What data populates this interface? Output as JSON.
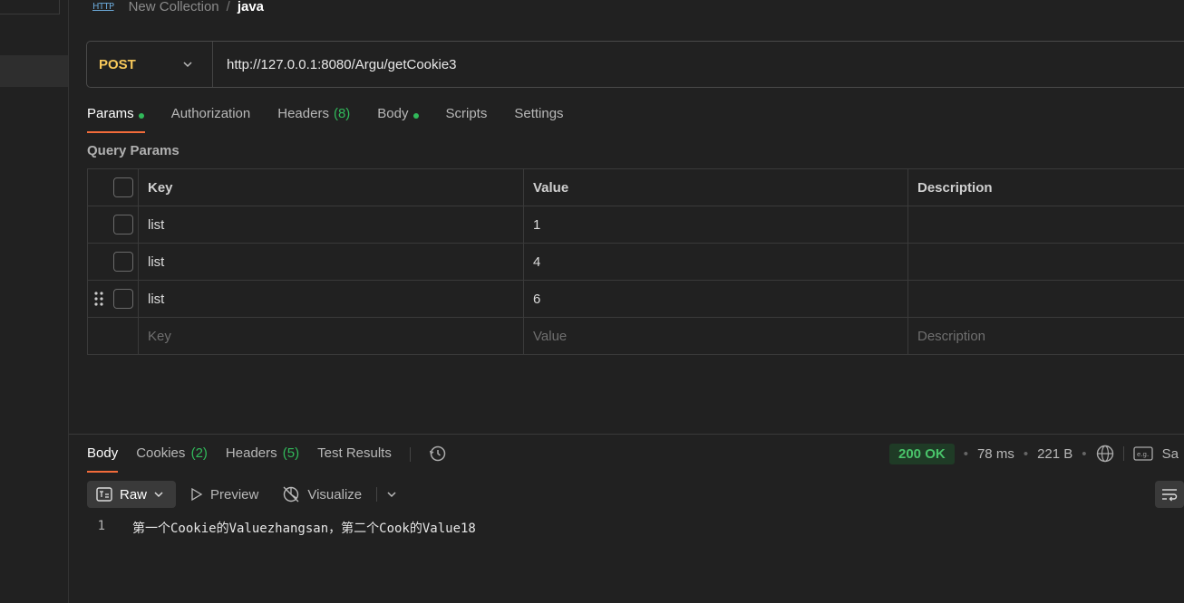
{
  "breadcrumb": {
    "icon_text": "HTTP",
    "parent": "New Collection",
    "separator": "/",
    "current": "java"
  },
  "request": {
    "method": "POST",
    "url": "http://127.0.0.1:8080/Argu/getCookie3"
  },
  "request_tabs": [
    {
      "label": "Params",
      "dot": true,
      "active": true
    },
    {
      "label": "Authorization"
    },
    {
      "label": "Headers",
      "count": "(8)"
    },
    {
      "label": "Body",
      "dot": true
    },
    {
      "label": "Scripts"
    },
    {
      "label": "Settings"
    }
  ],
  "query_params": {
    "title": "Query Params",
    "headers": {
      "key": "Key",
      "value": "Value",
      "description": "Description"
    },
    "rows": [
      {
        "key": "list",
        "value": "1",
        "description": ""
      },
      {
        "key": "list",
        "value": "4",
        "description": ""
      },
      {
        "key": "list",
        "value": "6",
        "description": ""
      }
    ],
    "placeholders": {
      "key": "Key",
      "value": "Value",
      "description": "Description"
    }
  },
  "response_tabs": {
    "body": "Body",
    "cookies": "Cookies",
    "cookies_count": "(2)",
    "headers": "Headers",
    "headers_count": "(5)",
    "test_results": "Test Results"
  },
  "response_status": {
    "status": "200 OK",
    "time": "78 ms",
    "size": "221 B",
    "save_label_partial": "Sa"
  },
  "view_modes": {
    "raw": "Raw",
    "preview": "Preview",
    "visualize": "Visualize"
  },
  "response_body": {
    "line_number": "1",
    "text": "第一个Cookie的Valuezhangsan，第二个Cook的Value18"
  },
  "colors": {
    "method": "#f7c85a",
    "accent": "#f26b3a",
    "success": "#31b95a"
  }
}
